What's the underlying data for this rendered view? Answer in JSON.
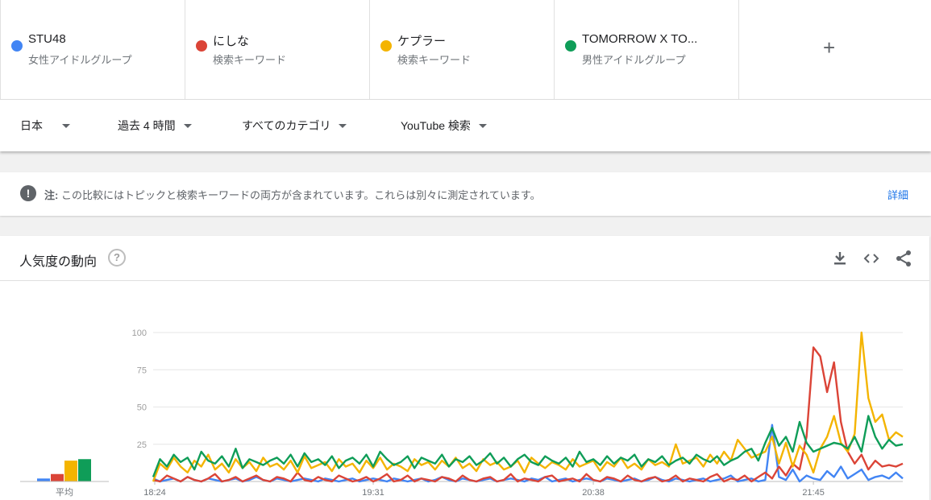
{
  "terms": [
    {
      "name": "STU48",
      "type": "女性アイドルグループ",
      "color": "#4285f4"
    },
    {
      "name": "にしな",
      "type": "検索キーワード",
      "color": "#db4437"
    },
    {
      "name": "ケプラー",
      "type": "検索キーワード",
      "color": "#f4b400"
    },
    {
      "name": "TOMORROW X TO...",
      "type": "男性アイドルグループ",
      "color": "#0f9d58"
    }
  ],
  "add_term_label": "+",
  "filters": {
    "region": "日本",
    "time": "過去 4 時間",
    "category": "すべてのカテゴリ",
    "search_type": "YouTube 検索"
  },
  "notice": {
    "icon_label": "!",
    "prefix": "注:",
    "text": " この比較にはトピックと検索キーワードの両方が含まれています。これらは別々に測定されています。",
    "link": "詳細"
  },
  "card": {
    "title": "人気度の動向",
    "help_label": "?",
    "icons": [
      "download-icon",
      "embed-icon",
      "share-icon"
    ]
  },
  "chart_data": {
    "type": "line",
    "y_ticks": [
      "100",
      "75",
      "50",
      "25"
    ],
    "ylim": [
      0,
      100
    ],
    "x_ticks": [
      "18:24",
      "19:31",
      "20:38",
      "21:45"
    ],
    "average_label": "平均",
    "averages": [
      {
        "name": "STU48",
        "value": 2,
        "color": "#4285f4"
      },
      {
        "name": "にしな",
        "value": 5,
        "color": "#db4437"
      },
      {
        "name": "ケプラー",
        "value": 14,
        "color": "#f4b400"
      },
      {
        "name": "TOMORROW X TO...",
        "value": 15,
        "color": "#0f9d58"
      }
    ],
    "series": [
      {
        "name": "STU48",
        "color": "#4285f4",
        "values": [
          2,
          0,
          1,
          2,
          0,
          3,
          1,
          0,
          2,
          1,
          0,
          1,
          2,
          0,
          1,
          3,
          1,
          0,
          2,
          1,
          0,
          1,
          2,
          1,
          0,
          2,
          1,
          0,
          1,
          2,
          0,
          1,
          2,
          1,
          0,
          2,
          1,
          0,
          1,
          2,
          0,
          1,
          3,
          1,
          0,
          2,
          1,
          0,
          1,
          2,
          0,
          1,
          2,
          1,
          0,
          2,
          1,
          3,
          0,
          1,
          2,
          0,
          1,
          2,
          1,
          0,
          2,
          1,
          0,
          1,
          2,
          0,
          1,
          3,
          1,
          0,
          2,
          1,
          0,
          1,
          2,
          0,
          1,
          2,
          4,
          0,
          1,
          2,
          0,
          1,
          38,
          3,
          1,
          8,
          0,
          4,
          2,
          1,
          7,
          3,
          10,
          2,
          5,
          8,
          1,
          3,
          4,
          2,
          6,
          2
        ]
      },
      {
        "name": "にしな",
        "color": "#db4437",
        "values": [
          1,
          0,
          4,
          2,
          0,
          3,
          1,
          0,
          2,
          5,
          0,
          1,
          3,
          0,
          2,
          4,
          1,
          0,
          3,
          2,
          0,
          6,
          1,
          0,
          3,
          1,
          0,
          4,
          2,
          0,
          1,
          3,
          0,
          2,
          5,
          0,
          1,
          4,
          0,
          2,
          1,
          0,
          3,
          2,
          0,
          4,
          1,
          0,
          2,
          3,
          0,
          1,
          5,
          0,
          2,
          1,
          0,
          3,
          4,
          0,
          1,
          2,
          0,
          5,
          1,
          0,
          3,
          2,
          0,
          4,
          1,
          0,
          2,
          3,
          0,
          1,
          4,
          0,
          2,
          1,
          0,
          3,
          5,
          0,
          2,
          1,
          4,
          0,
          3,
          6,
          2,
          10,
          4,
          12,
          8,
          30,
          90,
          84,
          60,
          80,
          40,
          20,
          12,
          18,
          8,
          14,
          10,
          11,
          10,
          12
        ]
      },
      {
        "name": "ケプラー",
        "color": "#f4b400",
        "values": [
          0,
          12,
          8,
          16,
          10,
          6,
          14,
          10,
          18,
          8,
          12,
          6,
          15,
          9,
          13,
          7,
          16,
          10,
          12,
          8,
          14,
          6,
          17,
          9,
          11,
          13,
          7,
          15,
          10,
          12,
          6,
          14,
          9,
          16,
          8,
          12,
          10,
          7,
          15,
          11,
          13,
          8,
          14,
          10,
          16,
          9,
          12,
          7,
          15,
          11,
          13,
          8,
          10,
          14,
          6,
          16,
          12,
          9,
          13,
          11,
          8,
          15,
          10,
          12,
          14,
          7,
          13,
          10,
          16,
          9,
          12,
          8,
          15,
          11,
          13,
          10,
          25,
          12,
          14,
          16,
          10,
          18,
          12,
          20,
          14,
          28,
          22,
          16,
          18,
          20,
          30,
          12,
          26,
          10,
          24,
          18,
          6,
          22,
          30,
          44,
          26,
          20,
          32,
          100,
          56,
          40,
          45,
          28,
          33,
          30
        ]
      },
      {
        "name": "TOMORROW X TO...",
        "color": "#0f9d58",
        "values": [
          3,
          15,
          10,
          18,
          13,
          16,
          8,
          20,
          14,
          12,
          17,
          10,
          22,
          9,
          15,
          13,
          11,
          14,
          16,
          12,
          18,
          10,
          19,
          13,
          15,
          11,
          17,
          9,
          14,
          16,
          12,
          18,
          10,
          20,
          15,
          11,
          13,
          17,
          9,
          16,
          14,
          12,
          18,
          10,
          15,
          13,
          17,
          11,
          14,
          19,
          12,
          16,
          10,
          15,
          18,
          13,
          11,
          17,
          14,
          12,
          16,
          10,
          20,
          13,
          15,
          11,
          17,
          12,
          16,
          14,
          18,
          10,
          15,
          13,
          17,
          11,
          14,
          16,
          12,
          18,
          15,
          13,
          17,
          11,
          14,
          16,
          20,
          22,
          14,
          26,
          36,
          24,
          30,
          20,
          40,
          26,
          20,
          22,
          24,
          26,
          25,
          22,
          30,
          20,
          44,
          30,
          22,
          28,
          24,
          25
        ]
      }
    ]
  }
}
